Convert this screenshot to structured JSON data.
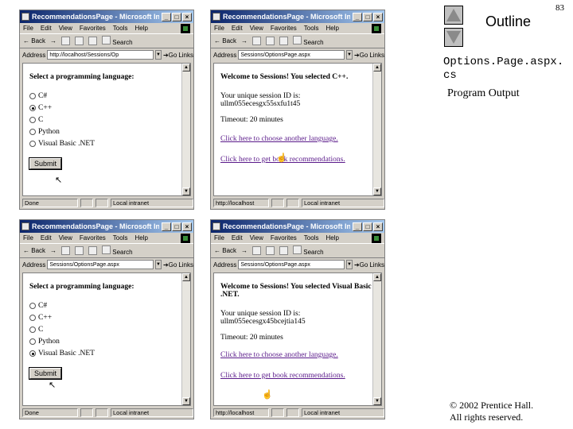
{
  "slide": {
    "outline_label": "Outline",
    "page_number": "83",
    "file_name_line1": "Options.Page.aspx.",
    "file_name_line2": "cs",
    "subtitle": "Program Output",
    "copyright_line1": "© 2002 Prentice Hall.",
    "copyright_line2": "All rights reserved."
  },
  "browser": {
    "title": "RecommendationsPage - Microsoft Intern...",
    "menu": [
      "File",
      "Edit",
      "View",
      "Favorites",
      "Tools",
      "Help"
    ],
    "toolbar_back": "Back",
    "toolbar_search": "Search",
    "address_label": "Address",
    "go_label": "Go",
    "links_label": "Links",
    "status_zone": "Local intranet"
  },
  "windows": [
    {
      "address": "http://localhost/Sessions/Op",
      "status_left": "Done",
      "heading": "Select a programming language:",
      "options": [
        "C#",
        "C++",
        "C",
        "Python",
        "Visual Basic .NET"
      ],
      "selected": 1,
      "submit_label": "Submit"
    },
    {
      "address": "Sessions/OptionsPage.aspx",
      "status_left": "http://localhost",
      "welcome": "Welcome to Sessions! You selected C++.",
      "session_label": "Your unique session ID is:",
      "session_id": "ullm055ecesgx55sxfu1t45",
      "timeout": "Timeout: 20 minutes",
      "link_choose": "Click here to choose another language.",
      "link_books": "Click here to get book recommendations."
    },
    {
      "address": "Sessions/OptionsPage.aspx",
      "status_left": "Done",
      "heading": "Select a programming language:",
      "options": [
        "C#",
        "C++",
        "C",
        "Python",
        "Visual Basic .NET"
      ],
      "selected": 4,
      "submit_label": "Submit"
    },
    {
      "address": "Sessions/OptionsPage.aspx",
      "status_left": "http://localhost",
      "welcome": "Welcome to Sessions! You selected Visual Basic .NET.",
      "session_label": "Your unique session ID is:",
      "session_id": "ullm055ecesgx45bcejtia145",
      "timeout": "Timeout: 20 minutes",
      "link_choose": "Click here to choose another language.",
      "link_books": "Click here to get book recommendations."
    }
  ]
}
